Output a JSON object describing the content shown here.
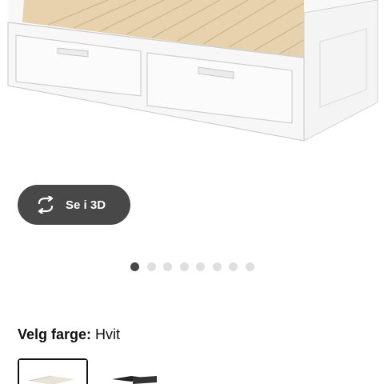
{
  "product": {
    "image_alt": "White daybed with two drawers and wooden slats"
  },
  "viewer": {
    "view_3d_label": "Se i 3D",
    "view_3d_icon": "rotate-3d-icon"
  },
  "carousel": {
    "total_images": 8,
    "active_index": 0
  },
  "colour": {
    "label": "Velg farge:",
    "value": "Hvit",
    "options": [
      {
        "name": "Hvit",
        "selected": true,
        "color": "#ffffff"
      },
      {
        "name": "",
        "selected": false,
        "color": "#222222"
      }
    ]
  },
  "colors": {
    "button_bg": "#484848",
    "dot_active": "#484848",
    "dot_inactive": "#dfdfdf",
    "slat_wood": "#e8d2ad",
    "frame_white": "#f7f7f7"
  }
}
